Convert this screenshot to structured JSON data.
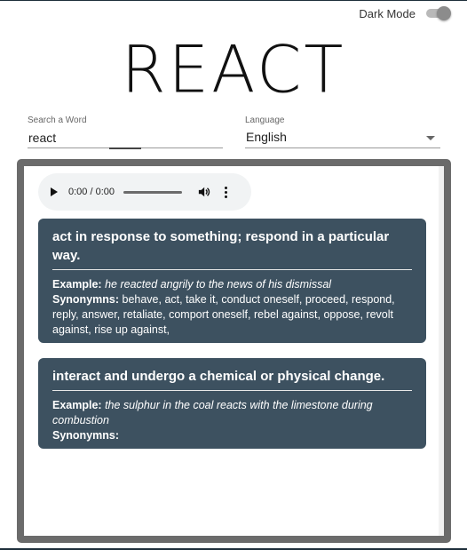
{
  "header": {
    "dark_mode_label": "Dark Mode",
    "dark_mode_on": true,
    "logo": "REACT"
  },
  "search": {
    "label": "Search a Word",
    "value": "react"
  },
  "language": {
    "label": "Language",
    "value": "English"
  },
  "audio": {
    "time": "0:00 / 0:00"
  },
  "definitions": [
    {
      "definition": "act in response to something; respond in a particular way.",
      "example_label": "Example:",
      "example": "he reacted angrily to the news of his dismissal",
      "synonyms_label": "Synonymns:",
      "synonyms": "behave, act, take it, conduct oneself, proceed, respond, reply, answer, retaliate, comport oneself, rebel against, oppose, revolt against, rise up against,"
    },
    {
      "definition": "interact and undergo a chemical or physical change.",
      "example_label": "Example:",
      "example": "the sulphur in the coal reacts with the limestone during combustion",
      "synonyms_label": "Synonymns:",
      "synonyms": ""
    }
  ],
  "colors": {
    "card": "#3d5160",
    "frame": "#6b6b6b"
  }
}
